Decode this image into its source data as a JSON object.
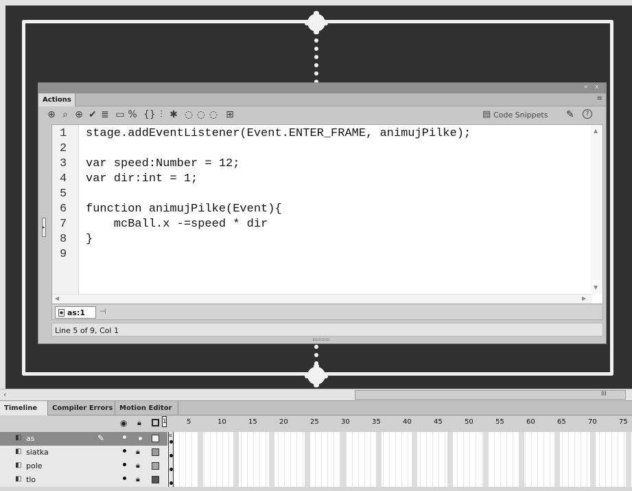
{
  "stage": {
    "background": "#303030",
    "line_color": "#f2f2f2"
  },
  "actions_panel": {
    "tab_label": "Actions",
    "collapse_controls": "«",
    "close_control": "x",
    "menu_icon": "≡",
    "code_snippets_label": "Code Snippets",
    "toolbar_icons": [
      "add-statement-icon",
      "find-icon",
      "insert-target-path-icon",
      "check-syntax-icon",
      "auto-format-icon",
      "show-code-hint-icon",
      "debug-options-icon",
      "collapse-between-braces-icon",
      "collapse-selection-icon",
      "expand-all-icon",
      "apply-block-comment-icon",
      "apply-line-comment-icon",
      "remove-comment-icon",
      "show-hide-toolbox-icon"
    ],
    "code_lines": [
      {
        "num": "1",
        "text": "stage.addEventListener(Event.ENTER_FRAME, animujPilke);"
      },
      {
        "num": "2",
        "text": ""
      },
      {
        "num": "3",
        "text": "var speed:Number = 12;"
      },
      {
        "num": "4",
        "text": "var dir:int = 1;"
      },
      {
        "num": "5",
        "text": ""
      },
      {
        "num": "6",
        "text": "function animujPilke(Event){"
      },
      {
        "num": "7",
        "text": "    mcBall.x -=speed * dir"
      },
      {
        "num": "8",
        "text": "}"
      },
      {
        "num": "9",
        "text": ""
      }
    ],
    "script_tab_label": "as:1",
    "status_text": "Line 5 of 9, Col 1"
  },
  "stage_scrollbar": {
    "grip": "III"
  },
  "timeline": {
    "tabs": [
      "Timeline",
      "Compiler Errors",
      "Motion Editor"
    ],
    "active_tab": "Timeline",
    "playhead_frame": "1",
    "frame_numbers": [
      "5",
      "10",
      "15",
      "20",
      "25",
      "30",
      "35",
      "40",
      "45",
      "50",
      "55",
      "60",
      "65",
      "70",
      "75"
    ],
    "layers": [
      {
        "name": "as",
        "selected": true
      },
      {
        "name": "siatka",
        "selected": false
      },
      {
        "name": "pole",
        "selected": false
      },
      {
        "name": "tlo",
        "selected": false
      }
    ]
  }
}
